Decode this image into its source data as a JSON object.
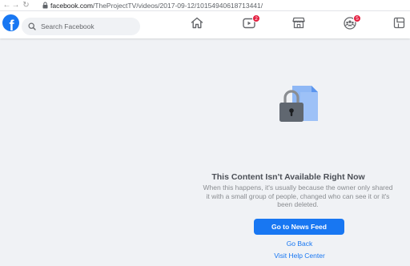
{
  "browser": {
    "url_domain": "facebook.com",
    "url_path": "/TheProjectTV/videos/2017-09-12/10154940618713441/"
  },
  "header": {
    "logo_letter": "f",
    "search_placeholder": "Search Facebook",
    "nav": [
      {
        "icon": "home-icon",
        "badge": ""
      },
      {
        "icon": "watch-icon",
        "badge": "2"
      },
      {
        "icon": "marketplace-icon",
        "badge": ""
      },
      {
        "icon": "groups-icon",
        "badge": "5"
      },
      {
        "icon": "gaming-icon",
        "badge": ""
      }
    ]
  },
  "error": {
    "title": "This Content Isn't Available Right Now",
    "description": "When this happens, it's usually because the owner only shared it with a small group of people, changed who can see it or it's been deleted.",
    "primary_button": "Go to News Feed",
    "back_link": "Go Back",
    "help_link": "Visit Help Center"
  },
  "colors": {
    "brand": "#1877f2",
    "badge": "#e41e3f",
    "background": "#f0f2f5"
  }
}
